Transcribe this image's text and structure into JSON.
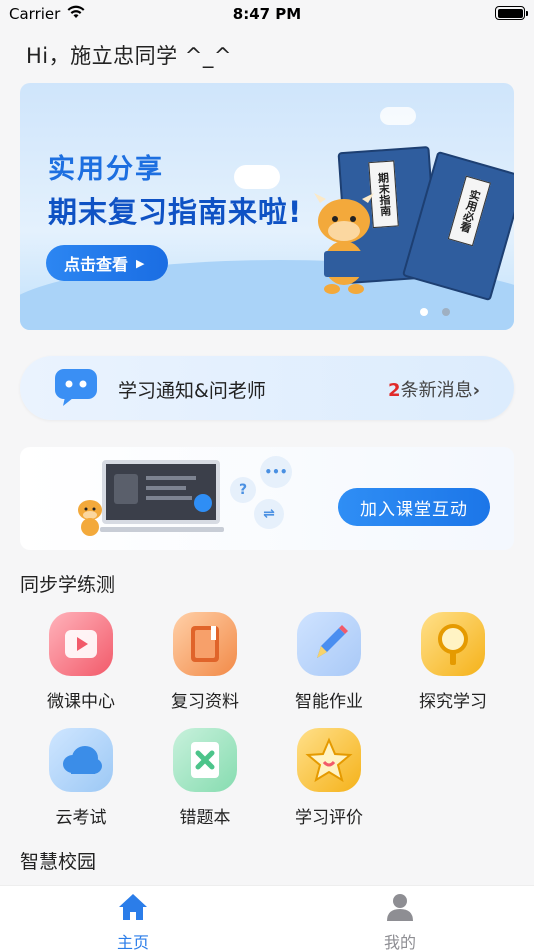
{
  "status_bar": {
    "carrier": "Carrier",
    "time": "8:47 PM"
  },
  "greeting": "Hi，施立忠同学  ^_^",
  "banner": {
    "title1": "实用分享",
    "title2": "期末复习指南来啦!",
    "cta": "点击查看",
    "book1": "期末指南",
    "book2": "实用必看",
    "page_dots": 2,
    "active_dot": 0
  },
  "notice": {
    "label": "学习通知&问老师",
    "count": "2",
    "count_suffix": "条新消息",
    "chevron": "›"
  },
  "interact": {
    "button": "加入课堂互动"
  },
  "sync_section": {
    "title": "同步学练测",
    "items": [
      {
        "label": "微课中心",
        "icon": "video-play-icon",
        "color": "#f25a6a"
      },
      {
        "label": "复习资料",
        "icon": "book-icon",
        "color": "#f28a48"
      },
      {
        "label": "智能作业",
        "icon": "pencil-icon",
        "color": "#4a8ef0"
      },
      {
        "label": "探究学习",
        "icon": "magnifier-icon",
        "color": "#f5b21a"
      },
      {
        "label": "云考试",
        "icon": "cloud-icon",
        "color": "#3b8de8"
      },
      {
        "label": "错题本",
        "icon": "wrong-notebook-icon",
        "color": "#4cc48a"
      },
      {
        "label": "学习评价",
        "icon": "star-icon",
        "color": "#f5b21a"
      }
    ]
  },
  "campus_section": {
    "title": "智慧校园"
  },
  "tabbar": {
    "items": [
      {
        "label": "主页",
        "icon": "home-icon",
        "active": true
      },
      {
        "label": "我的",
        "icon": "profile-icon",
        "active": false
      }
    ],
    "active_color": "#2b7de9",
    "inactive_color": "#8e8e93"
  }
}
